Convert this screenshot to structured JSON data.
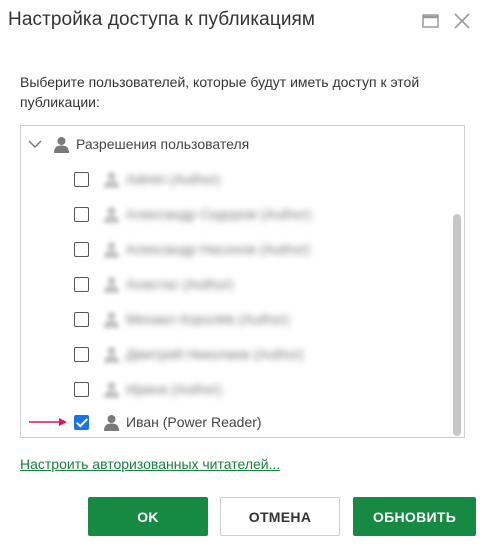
{
  "dialog": {
    "title": "Настройка доступа к публикациям",
    "maximize_icon": "maximize-icon",
    "close_icon": "close-icon"
  },
  "prompt": "Выберите пользователей, которые будут иметь доступ к этой публикации:",
  "tree": {
    "group_label": "Разрешения пользователя",
    "group_expanded": true,
    "items": [
      {
        "label": "Admin (Author)",
        "checked": false,
        "blurred": true
      },
      {
        "label": "Александр Сидоров (Author)",
        "checked": false,
        "blurred": true
      },
      {
        "label": "Александр Насонов (Author)",
        "checked": false,
        "blurred": true
      },
      {
        "label": "Анастас (Author)",
        "checked": false,
        "blurred": true
      },
      {
        "label": "Михаил Королёв (Author)",
        "checked": false,
        "blurred": true
      },
      {
        "label": "Дмитрий Николаев (Author)",
        "checked": false,
        "blurred": true
      },
      {
        "label": "Ирина (Author)",
        "checked": false,
        "blurred": true
      },
      {
        "label": "Иван (Power Reader)",
        "checked": true,
        "blurred": false
      }
    ]
  },
  "link": {
    "configure_readers": "Настроить авторизованных читателей..."
  },
  "buttons": {
    "ok": "OK",
    "cancel": "ОТМЕНА",
    "update": "ОБНОВИТЬ"
  },
  "colors": {
    "primary_green": "#168a43",
    "link_green": "#17823e",
    "checkbox_blue": "#1a73e8",
    "annotation_arrow": "#e0115f"
  }
}
